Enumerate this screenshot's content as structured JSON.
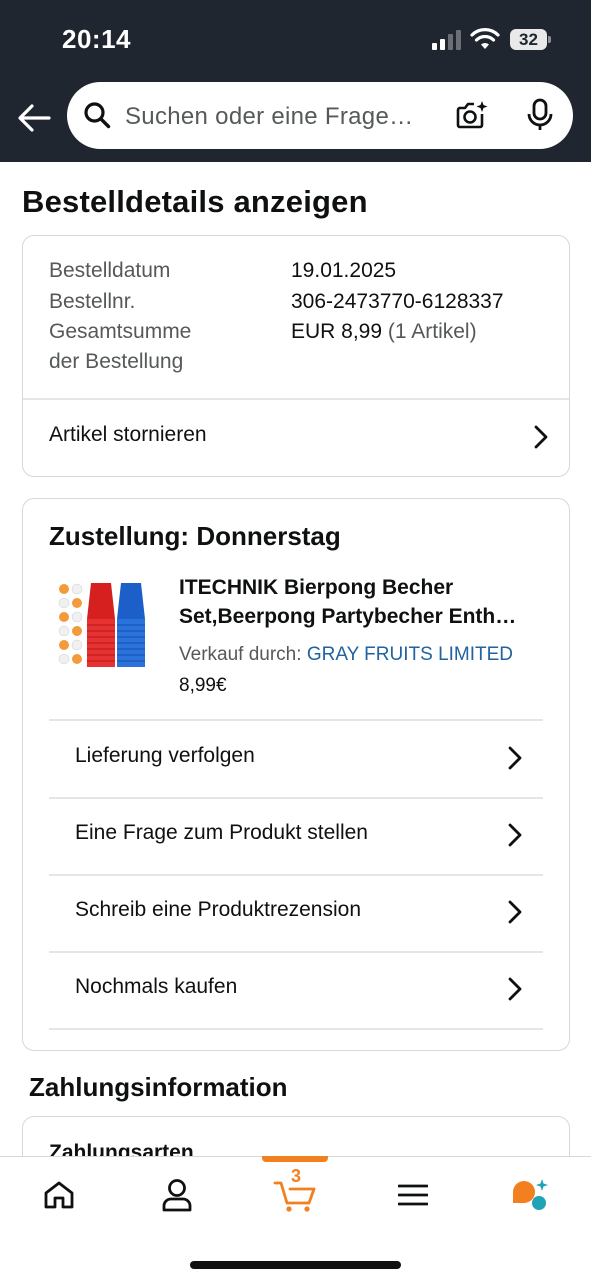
{
  "status_bar": {
    "time": "20:14",
    "battery": "32"
  },
  "search": {
    "placeholder": "Suchen oder eine Frage…"
  },
  "page": {
    "title": "Bestelldetails anzeigen"
  },
  "order_summary": {
    "rows": [
      {
        "label": "Bestelldatum",
        "value": "19.01.2025"
      },
      {
        "label": "Bestellnr.",
        "value": "306-2473770-6128337"
      },
      {
        "label_line1": "Gesamtsumme",
        "label_line2": "der Bestellung",
        "value": "EUR 8,99",
        "value_suffix": "(1 Artikel)"
      }
    ],
    "cancel_label": "Artikel stornieren"
  },
  "delivery": {
    "title": "Zustellung: Donnerstag",
    "product": {
      "title_line1": "ITECHNIK Bierpong Becher",
      "title_line2": "Set,Beerpong Partybecher Enth…",
      "seller_prefix": "Verkauf durch:",
      "seller_name": "GRAY FRUITS LIMITED",
      "price": "8,99€"
    },
    "actions": [
      {
        "label": "Lieferung verfolgen"
      },
      {
        "label": "Eine Frage zum Produkt stellen"
      },
      {
        "label": "Schreib eine Produktrezension"
      },
      {
        "label": "Nochmals kaufen"
      }
    ]
  },
  "payment": {
    "title": "Zahlungsinformation",
    "subtitle": "Zahlungsarten"
  },
  "bottom_nav": {
    "items": [
      "home-icon",
      "account-icon",
      "cart-icon",
      "menu-icon",
      "rufus-ai-icon"
    ],
    "cart_count": "3",
    "active": "cart-icon"
  },
  "colors": {
    "header_bg": "#1f2630",
    "link": "#2162a1",
    "accent_orange": "#f3801f",
    "border": "#d5d9d9"
  }
}
